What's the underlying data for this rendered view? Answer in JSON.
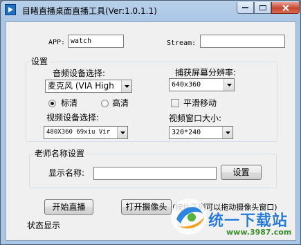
{
  "window": {
    "title": "目睹直播桌面直播工具(Ver:1.0.1.1)"
  },
  "fields": {
    "app_label": "APP:",
    "app_value": "watch",
    "stream_label": "Stream:",
    "stream_value": ""
  },
  "settings": {
    "group_title": "设置",
    "audio_label": "音频设备选择:",
    "audio_value": "麦克风 (VIA High",
    "capture_res_label": "捕获屏幕分辨率:",
    "capture_res_value": "640x360",
    "quality_standard": "标清",
    "quality_high": "高清",
    "selected_quality": "标清",
    "smooth_move_label": "平滑移动",
    "smooth_move_checked": false,
    "video_label": "视频设备选择:",
    "video_value": "480X360 69xiu Vir",
    "video_window_label": "视频窗口大小:",
    "video_window_value": "320*240"
  },
  "teacher": {
    "group_title": "老师名称设置",
    "display_name_label": "显示名称:",
    "display_name_value": "",
    "set_button": "设置"
  },
  "actions": {
    "start_live": "开始直播",
    "open_camera": "打开摄像头",
    "camera_hint": "(按住下列可以拖动摄像头窗口)"
  },
  "status": {
    "label": "状态显示"
  },
  "watermark": {
    "brand": "统一下载站",
    "url": "www.3987.com"
  }
}
